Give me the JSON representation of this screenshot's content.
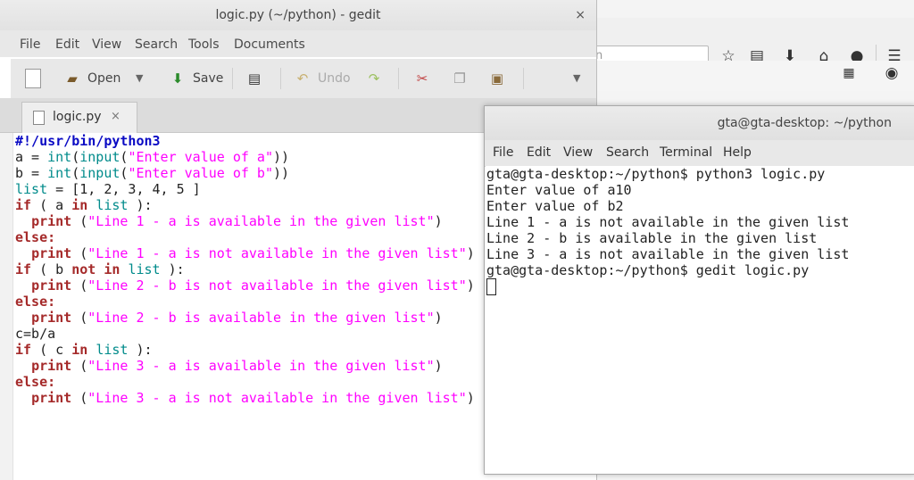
{
  "gedit": {
    "title": "logic.py (~/python) - gedit",
    "close": "×",
    "menu": [
      "File",
      "Edit",
      "View",
      "Search",
      "Tools",
      "Documents"
    ],
    "toolbar": {
      "open": "Open",
      "save": "Save",
      "undo": "Undo"
    },
    "tab": {
      "label": "logic.py",
      "close": "×"
    },
    "code": {
      "l1": "#!/usr/bin/python3",
      "l2_a": "a = ",
      "l2_b": "int",
      "l2_c": "(",
      "l2_d": "input",
      "l2_e": "(",
      "l2_f": "\"Enter value of a\"",
      "l2_g": "))",
      "l3_a": "b = ",
      "l3_b": "int",
      "l3_c": "(",
      "l3_d": "input",
      "l3_e": "(",
      "l3_f": "\"Enter value of b\"",
      "l3_g": "))",
      "l4_a": "list",
      "l4_b": " = [1, 2, 3, 4, 5 ]",
      "l5_a": "if",
      "l5_b": " ( a ",
      "l5_c": "in",
      "l5_d": " ",
      "l5_e": "list",
      "l5_f": " ):",
      "l6_a": "  ",
      "l6_b": "print",
      "l6_c": " (",
      "l6_d": "\"Line 1 - a is available in the given list\"",
      "l6_e": ")",
      "l7": "else:",
      "l8_a": "  ",
      "l8_b": "print",
      "l8_c": " (",
      "l8_d": "\"Line 1 - a is not available in the given list\"",
      "l8_e": ")",
      "l9_a": "if",
      "l9_b": " ( b ",
      "l9_c": "not in",
      "l9_d": " ",
      "l9_e": "list",
      "l9_f": " ):",
      "l10_a": "  ",
      "l10_b": "print",
      "l10_c": " (",
      "l10_d": "\"Line 2 - b is not available in the given list\"",
      "l10_e": ")",
      "l11": "else:",
      "l12_a": "  ",
      "l12_b": "print",
      "l12_c": " (",
      "l12_d": "\"Line 2 - b is available in the given list\"",
      "l12_e": ")",
      "l13": "c=b/a",
      "l14_a": "if",
      "l14_b": " ( c ",
      "l14_c": "in",
      "l14_d": " ",
      "l14_e": "list",
      "l14_f": " ):",
      "l15_a": "  ",
      "l15_b": "print",
      "l15_c": " (",
      "l15_d": "\"Line 3 - a is available in the given list\"",
      "l15_e": ")",
      "l16": "else:",
      "l17_a": "  ",
      "l17_b": "print",
      "l17_c": " (",
      "l17_d": "\"Line 3 - a is not available in the given list\"",
      "l17_e": ")"
    }
  },
  "terminal": {
    "title": "gta@gta-desktop: ~/python",
    "menu": [
      "File",
      "Edit",
      "View",
      "Search",
      "Terminal",
      "Help"
    ],
    "lines": [
      "gta@gta-desktop:~/python$ python3 logic.py",
      "Enter value of a10",
      "Enter value of b2",
      "Line 1 - a is not available in the given list",
      "Line 2 - b is available in the given list",
      "Line 3 - a is not available in the given list",
      "gta@gta-desktop:~/python$ gedit logic.py"
    ]
  },
  "browser": {
    "search_fragment": "n"
  },
  "colors": {
    "keyword": "#a52a2a",
    "builtin": "#008b8b",
    "string": "#ff00ff",
    "shebang": "#0a0ac4"
  }
}
